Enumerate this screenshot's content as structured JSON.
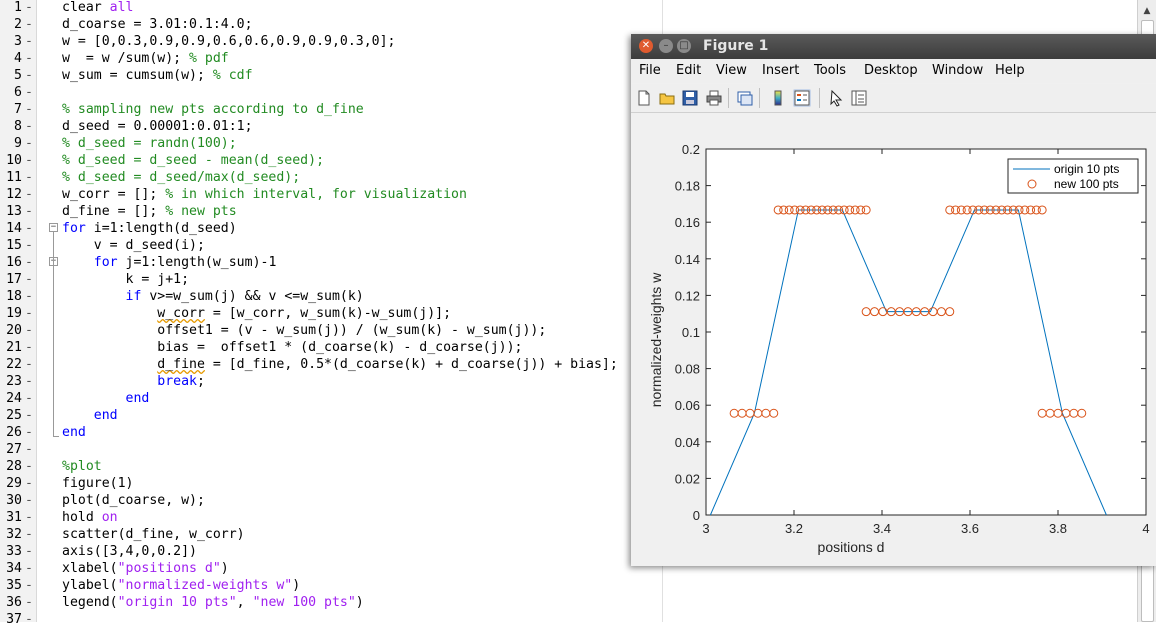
{
  "editor": {
    "lines": [
      {
        "n": "1",
        "tokens": [
          [
            "plain",
            "clear "
          ],
          [
            "string",
            "all"
          ]
        ]
      },
      {
        "n": "2",
        "tokens": [
          [
            "plain",
            "d_coarse = 3.01:0.1:4.0;"
          ]
        ]
      },
      {
        "n": "3",
        "tokens": [
          [
            "plain",
            "w = [0,0.3,0.9,0.9,0.6,0.6,0.9,0.9,0.3,0];"
          ]
        ]
      },
      {
        "n": "4",
        "tokens": [
          [
            "plain",
            "w  = w /sum(w); "
          ],
          [
            "comment",
            "% pdf"
          ]
        ]
      },
      {
        "n": "5",
        "tokens": [
          [
            "plain",
            "w_sum = cumsum(w); "
          ],
          [
            "comment",
            "% cdf"
          ]
        ]
      },
      {
        "n": "6",
        "tokens": []
      },
      {
        "n": "7",
        "tokens": [
          [
            "comment",
            "% sampling new pts according to d_fine"
          ]
        ]
      },
      {
        "n": "8",
        "tokens": [
          [
            "plain",
            "d_seed = 0.00001:0.01:1;"
          ]
        ]
      },
      {
        "n": "9",
        "tokens": [
          [
            "comment",
            "% d_seed = randn(100);"
          ]
        ]
      },
      {
        "n": "10",
        "tokens": [
          [
            "comment",
            "% d_seed = d_seed - mean(d_seed);"
          ]
        ]
      },
      {
        "n": "11",
        "tokens": [
          [
            "comment",
            "% d_seed = d_seed/max(d_seed);"
          ]
        ]
      },
      {
        "n": "12",
        "tokens": [
          [
            "plain",
            "w_corr = []; "
          ],
          [
            "comment",
            "% in which interval, for visualization"
          ]
        ]
      },
      {
        "n": "13",
        "tokens": [
          [
            "plain",
            "d_fine = []; "
          ],
          [
            "comment",
            "% new pts"
          ]
        ]
      },
      {
        "n": "14",
        "fold": "start",
        "tokens": [
          [
            "keyword",
            "for "
          ],
          [
            "plain",
            "i=1:length(d_seed)"
          ]
        ]
      },
      {
        "n": "15",
        "tokens": [
          [
            "plain",
            "    v = d_seed(i);"
          ]
        ]
      },
      {
        "n": "16",
        "fold": "start2",
        "tokens": [
          [
            "plain",
            "    "
          ],
          [
            "keyword",
            "for "
          ],
          [
            "plain",
            "j=1:length(w_sum)-1"
          ]
        ]
      },
      {
        "n": "17",
        "tokens": [
          [
            "plain",
            "        k = j+1;"
          ]
        ]
      },
      {
        "n": "18",
        "tokens": [
          [
            "plain",
            "        "
          ],
          [
            "keyword",
            "if "
          ],
          [
            "plain",
            "v>=w_sum(j) && v <=w_sum(k)"
          ]
        ]
      },
      {
        "n": "19",
        "tokens": [
          [
            "plain",
            "            "
          ],
          [
            "warn",
            "w_corr"
          ],
          [
            "plain",
            " = [w_corr, w_sum(k)-w_sum(j)];"
          ]
        ]
      },
      {
        "n": "20",
        "tokens": [
          [
            "plain",
            "            offset1 = (v - w_sum(j)) / (w_sum(k) - w_sum(j));"
          ]
        ]
      },
      {
        "n": "21",
        "tokens": [
          [
            "plain",
            "            bias =  offset1 * (d_coarse(k) - d_coarse(j));"
          ]
        ]
      },
      {
        "n": "22",
        "tokens": [
          [
            "plain",
            "            "
          ],
          [
            "warn",
            "d_fine"
          ],
          [
            "plain",
            " = [d_fine, 0.5*(d_coarse(k) + d_coarse(j)) + bias];"
          ]
        ]
      },
      {
        "n": "23",
        "tokens": [
          [
            "plain",
            "            "
          ],
          [
            "keyword",
            "break"
          ],
          [
            "plain",
            ";"
          ]
        ]
      },
      {
        "n": "24",
        "tokens": [
          [
            "plain",
            "        "
          ],
          [
            "keyword",
            "end"
          ]
        ]
      },
      {
        "n": "25",
        "tokens": [
          [
            "plain",
            "    "
          ],
          [
            "keyword",
            "end"
          ]
        ]
      },
      {
        "n": "26",
        "fold": "end",
        "tokens": [
          [
            "keyword",
            "end"
          ]
        ]
      },
      {
        "n": "27",
        "tokens": []
      },
      {
        "n": "28",
        "tokens": [
          [
            "comment",
            "%plot"
          ]
        ]
      },
      {
        "n": "29",
        "tokens": [
          [
            "plain",
            "figure(1)"
          ]
        ]
      },
      {
        "n": "30",
        "tokens": [
          [
            "plain",
            "plot(d_coarse, w);"
          ]
        ]
      },
      {
        "n": "31",
        "tokens": [
          [
            "plain",
            "hold "
          ],
          [
            "string",
            "on"
          ]
        ]
      },
      {
        "n": "32",
        "tokens": [
          [
            "plain",
            "scatter(d_fine, w_corr)"
          ]
        ]
      },
      {
        "n": "33",
        "tokens": [
          [
            "plain",
            "axis([3,4,0,0.2])"
          ]
        ]
      },
      {
        "n": "34",
        "tokens": [
          [
            "plain",
            "xlabel("
          ],
          [
            "string",
            "\"positions d\""
          ],
          [
            "plain",
            ")"
          ]
        ]
      },
      {
        "n": "35",
        "tokens": [
          [
            "plain",
            "ylabel("
          ],
          [
            "string",
            "\"normalized-weights w\""
          ],
          [
            "plain",
            ")"
          ]
        ]
      },
      {
        "n": "36",
        "tokens": [
          [
            "plain",
            "legend("
          ],
          [
            "string",
            "\"origin 10 pts\""
          ],
          [
            "plain",
            ", "
          ],
          [
            "string",
            "\"new 100 pts\""
          ],
          [
            "plain",
            ")"
          ]
        ]
      },
      {
        "n": "37",
        "tokens": []
      }
    ],
    "colors": {
      "keyword": "#0000ff",
      "comment": "#228b22",
      "string": "#a020f0"
    }
  },
  "figure": {
    "title": "Figure 1",
    "menu": [
      "File",
      "Edit",
      "View",
      "Insert",
      "Tools",
      "Desktop",
      "Window",
      "Help"
    ],
    "toolbar": [
      "new-figure-icon",
      "open-file-icon",
      "save-icon",
      "print-icon",
      "link-plot-icon",
      "colorbar-icon",
      "legend-icon",
      "pointer-icon",
      "property-inspector-icon"
    ]
  },
  "chart_data": {
    "type": "line",
    "xlabel": "positions d",
    "ylabel": "normalized-weights w",
    "xlim": [
      3,
      4
    ],
    "ylim": [
      0,
      0.2
    ],
    "xticks": [
      "3",
      "3.2",
      "3.4",
      "3.6",
      "3.8",
      "4"
    ],
    "yticks": [
      "0",
      "0.02",
      "0.04",
      "0.06",
      "0.08",
      "0.1",
      "0.12",
      "0.14",
      "0.16",
      "0.18",
      "0.2"
    ],
    "grid": false,
    "legend_position": "top-right",
    "series": [
      {
        "name": "origin 10 pts",
        "type": "line",
        "color": "#0072bd",
        "x": [
          3.01,
          3.11,
          3.21,
          3.31,
          3.41,
          3.51,
          3.61,
          3.71,
          3.81,
          3.91
        ],
        "y": [
          0,
          0.0556,
          0.1667,
          0.1667,
          0.1111,
          0.1111,
          0.1667,
          0.1667,
          0.0556,
          0
        ]
      },
      {
        "name": "new 100 pts",
        "type": "scatter",
        "color": "#d95319",
        "groups": [
          {
            "x_start": 3.064,
            "x_end": 3.154,
            "count": 6,
            "y": 0.0556
          },
          {
            "x_start": 3.164,
            "x_end": 3.364,
            "count": 17,
            "y": 0.1667
          },
          {
            "x_start": 3.364,
            "x_end": 3.554,
            "count": 11,
            "y": 0.1111
          },
          {
            "x_start": 3.554,
            "x_end": 3.764,
            "count": 17,
            "y": 0.1667
          },
          {
            "x_start": 3.764,
            "x_end": 3.854,
            "count": 6,
            "y": 0.0556
          }
        ]
      }
    ]
  }
}
